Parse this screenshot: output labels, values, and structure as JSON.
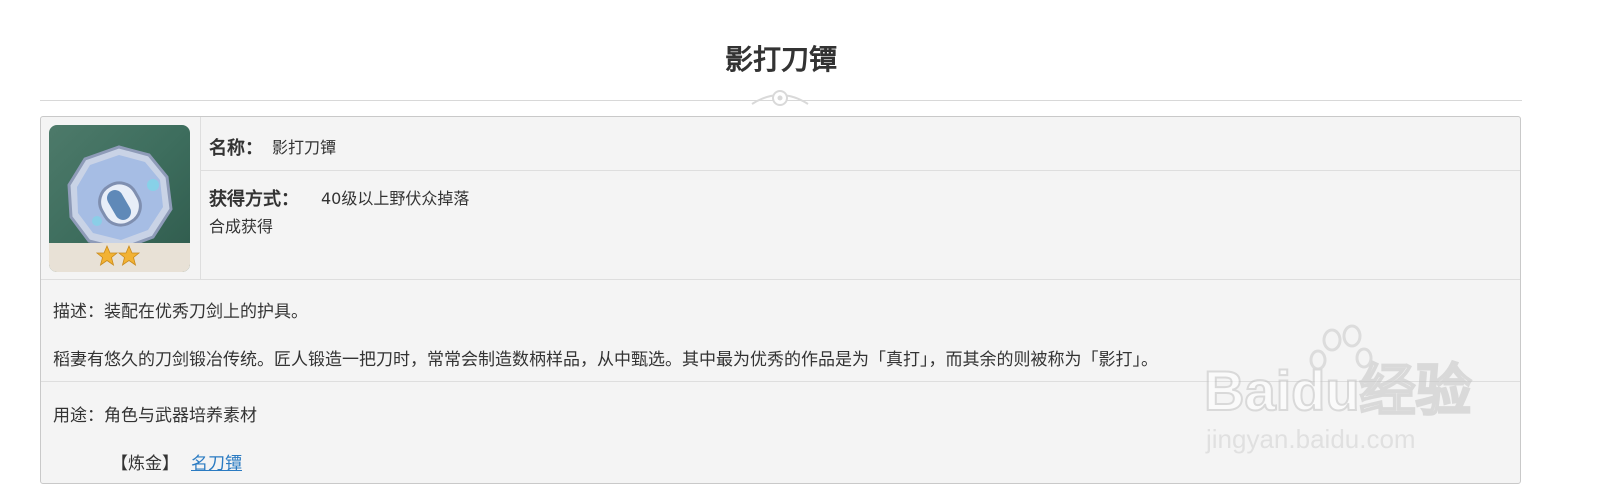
{
  "page": {
    "title": "影打刀镡"
  },
  "item": {
    "name_label": "名称：",
    "name_value": "影打刀镡",
    "source_label": "获得方式：",
    "source_line1": "40级以上野伏众掉落",
    "source_line2": "合成获得",
    "rarity_stars": 2
  },
  "description": {
    "label": "描述：",
    "line1": "装配在优秀刀剑上的护具。",
    "line2": "稻妻有悠久的刀剑锻冶传统。匠人锻造一把刀时，常常会制造数柄样品，从中甄选。其中最为优秀的作品是为「真打」，而其余的则被称为「影打」。"
  },
  "usage": {
    "label": "用途：",
    "value": "角色与武器培养素材",
    "alchemy_prefix": "【炼金】",
    "alchemy_link": "名刀镡"
  },
  "watermark": {
    "brand": "Baidu经验",
    "url": "jingyan.baidu.com"
  },
  "colors": {
    "link": "#2b7bc2",
    "star": "#f2b233",
    "icon_bg": "#3d6d5d"
  }
}
